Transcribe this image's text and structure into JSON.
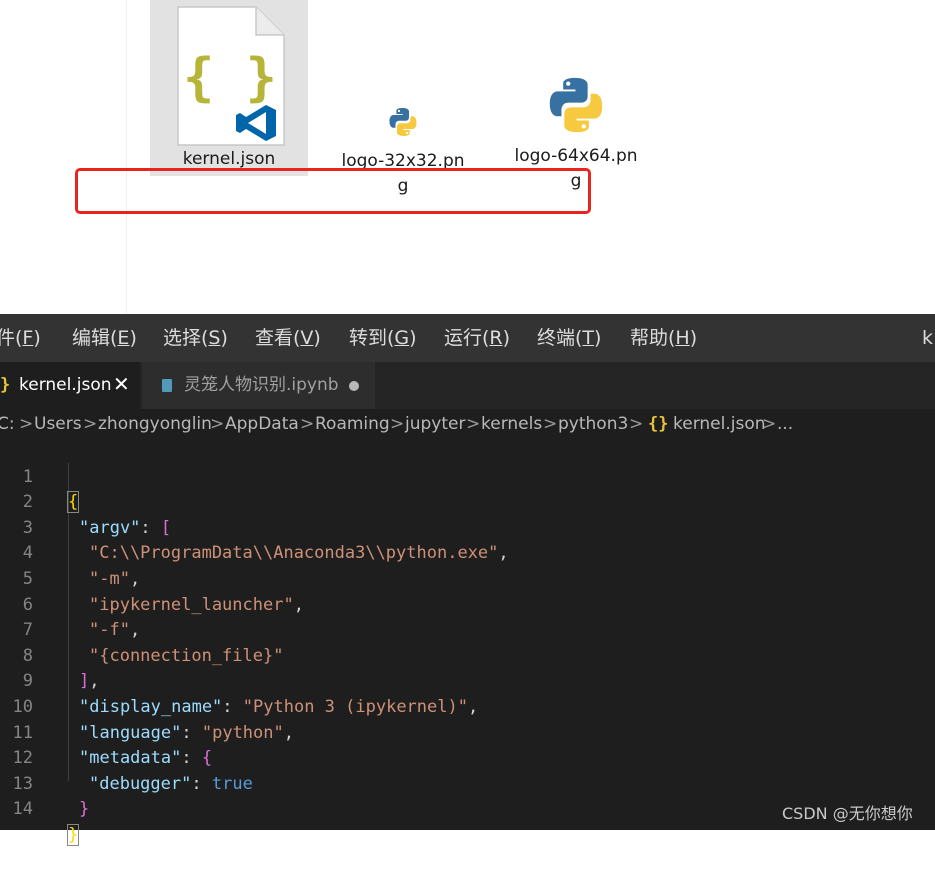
{
  "explorer": {
    "files": [
      {
        "name": "kernel.json",
        "selected": true,
        "icon": "json-file-icon"
      },
      {
        "name_line1": "logo-32x32.pn",
        "name_line2": "g",
        "icon": "python-logo-icon"
      },
      {
        "name_line1": "logo-64x64.pn",
        "name_line2": "g",
        "icon": "python-logo-icon"
      }
    ]
  },
  "menu": {
    "file": {
      "text": "件(",
      "key": "F",
      "end": ")"
    },
    "edit": {
      "text": "编辑(",
      "key": "E",
      "end": ")"
    },
    "selection": {
      "text": "选择(",
      "key": "S",
      "end": ")"
    },
    "view": {
      "text": "查看(",
      "key": "V",
      "end": ")"
    },
    "go": {
      "text": "转到(",
      "key": "G",
      "end": ")"
    },
    "run": {
      "text": "运行(",
      "key": "R",
      "end": ")"
    },
    "terminal": {
      "text": "终端(",
      "key": "T",
      "end": ")"
    },
    "help": {
      "text": "帮助(",
      "key": "H",
      "end": ")"
    },
    "overflow": "k"
  },
  "tabs": {
    "active": {
      "label": "kernel.json",
      "brace": "}",
      "close": "✕"
    },
    "inactive": {
      "label": "灵笼人物识别.ipynb"
    }
  },
  "breadcrumb": {
    "items": [
      "C:",
      "Users",
      "zhongyonglin",
      "AppData",
      "Roaming",
      "jupyter",
      "kernels",
      "python3",
      "kernel.json",
      "..."
    ],
    "separator": ">",
    "file_icon": "{}"
  },
  "editor": {
    "line_numbers": [
      "1",
      "2",
      "3",
      "4",
      "5",
      "6",
      "7",
      "8",
      "9",
      "10",
      "11",
      "12",
      "13",
      "14"
    ],
    "tokens": {
      "open_brace": "{",
      "argv_key": "\"argv\"",
      "colon": ":",
      "comma": ",",
      "open_bracket": "[",
      "python_path": "\"C:\\\\ProgramData\\\\Anaconda3\\\\python.exe\"",
      "m_flag": "\"-m\"",
      "launcher": "\"ipykernel_launcher\"",
      "f_flag": "\"-f\"",
      "conn_file": "\"{connection_file}\"",
      "close_bracket": "]",
      "display_key": "\"display_name\"",
      "display_val": "\"Python 3 (ipykernel)\"",
      "language_key": "\"language\"",
      "language_val": "\"python\"",
      "metadata_key": "\"metadata\"",
      "inner_open": "{",
      "debugger_key": "\"debugger\"",
      "true_val": "true",
      "inner_close": "}",
      "close_brace": "}"
    }
  },
  "colors": {
    "annotation": "#e8251d",
    "json_brace": "#e6c33a",
    "vscode_blue": "#0065a9"
  },
  "watermark": "CSDN @无你想你"
}
